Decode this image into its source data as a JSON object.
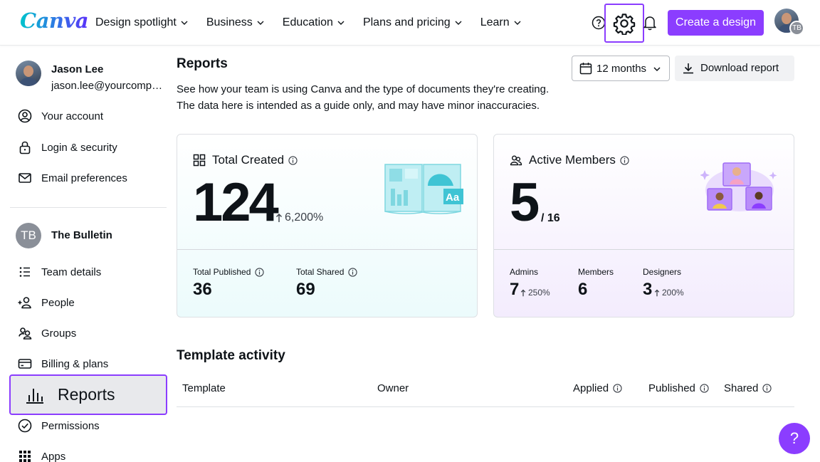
{
  "nav": {
    "logo": "Canva",
    "menu": [
      "Design spotlight",
      "Business",
      "Education",
      "Plans and pricing",
      "Learn"
    ],
    "create_label": "Create a design",
    "team_badge": "TB"
  },
  "sidebar": {
    "user_name": "Jason Lee",
    "user_email": "jason.lee@yourcompany.com",
    "account_items": [
      "Your account",
      "Login & security",
      "Email preferences"
    ],
    "team_initials": "TB",
    "team_name": "The Bulletin",
    "team_items": [
      "Team details",
      "People",
      "Groups",
      "Billing & plans"
    ],
    "active_item": "Reports",
    "more_items": [
      "Permissions",
      "Apps"
    ]
  },
  "main": {
    "title": "Reports",
    "desc_line1": "See how your team is using Canva and the type of documents they're creating.",
    "desc_line2": "The data here is intended as a guide only, and may have minor inaccuracies.",
    "period": "12 months",
    "download_label": "Download report",
    "total_created": {
      "title": "Total Created",
      "value": "124",
      "growth": "6,200%",
      "published_label": "Total Published",
      "published_value": "36",
      "shared_label": "Total Shared",
      "shared_value": "69"
    },
    "active_members": {
      "title": "Active Members",
      "value": "5",
      "total": "/ 16",
      "admins_label": "Admins",
      "admins_value": "7",
      "admins_growth": "250%",
      "members_label": "Members",
      "members_value": "6",
      "designers_label": "Designers",
      "designers_value": "3",
      "designers_growth": "200%"
    },
    "template_activity": {
      "title": "Template activity",
      "columns": [
        "Template",
        "Owner",
        "Applied",
        "Published",
        "Shared"
      ]
    }
  },
  "fab_label": "?",
  "colors": {
    "accent": "#8b3dff",
    "teal_tint": "#ecfbfc",
    "purple_tint": "#f3ecfd"
  }
}
